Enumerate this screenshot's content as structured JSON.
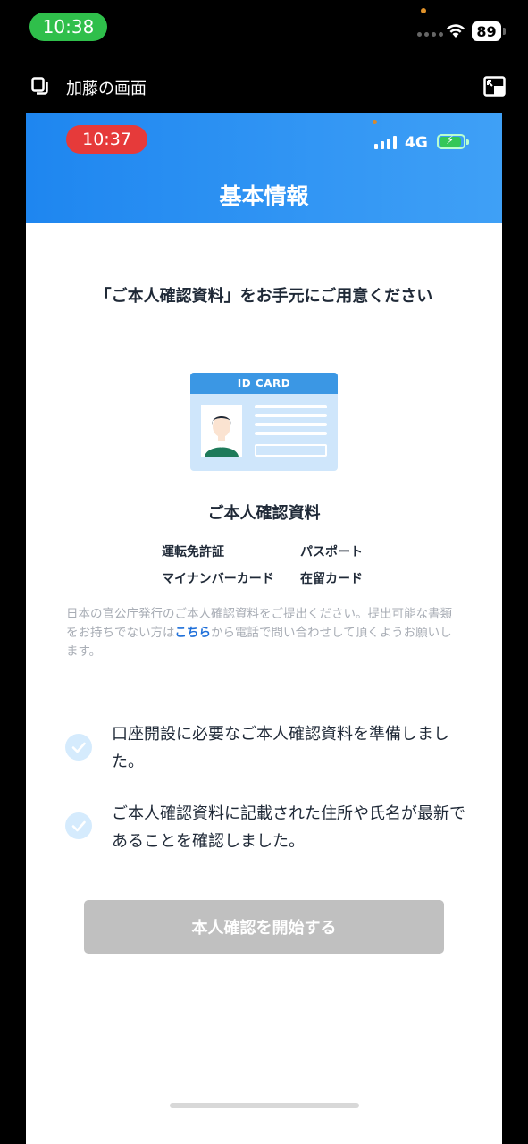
{
  "outer_status": {
    "time": "10:38",
    "battery": "89"
  },
  "share_bar": {
    "label": "加藤の画面",
    "share_icon": "screen-share-icon",
    "expand_icon": "picture-in-picture-icon"
  },
  "inner_status": {
    "time": "10:37",
    "network": "4G",
    "time_pill_color": "#e63a3a"
  },
  "header": {
    "title": "基本情報",
    "color": "#1e86f0"
  },
  "main": {
    "instruction": "「ご本人確認資料」をお手元にご用意ください",
    "id_card_label": "ID CARD",
    "doc_title": "ご本人確認資料",
    "doc_types": [
      "運転免許証",
      "パスポート",
      "マイナンバーカード",
      "在留カード"
    ],
    "note_before": "日本の官公庁発行のご本人確認資料をご提出ください。提出可能な書類をお持ちでない方は",
    "note_link": "こちら",
    "note_after": "から電話で問い合わせして頂くようお願いします。",
    "checks": [
      "口座開設に必要なご本人確認資料を準備しました。",
      "ご本人確認資料に記載された住所や氏名が最新であることを確認しました。"
    ],
    "start_button": "本人確認を開始する"
  }
}
